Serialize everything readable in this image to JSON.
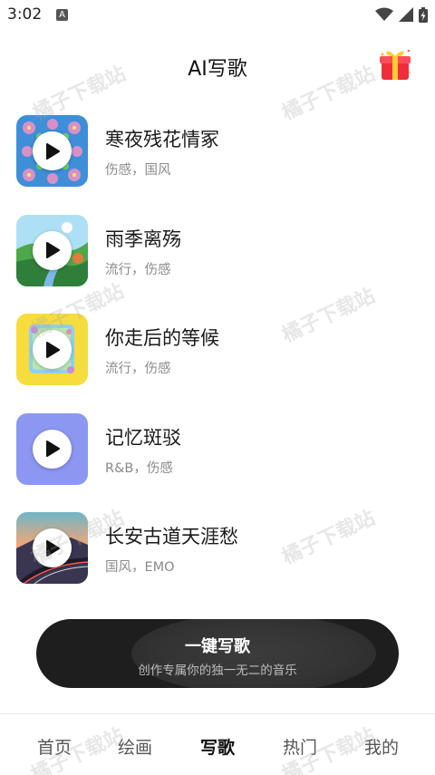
{
  "status_bar": {
    "time": "3:02",
    "notification_icon": "A",
    "icons": [
      "wifi-icon",
      "signal-icon",
      "battery-charging-icon"
    ]
  },
  "header": {
    "title": "AI写歌",
    "gift_icon": "gift-icon"
  },
  "songs": [
    {
      "title": "寒夜残花情冢",
      "tags": "伤感，国风",
      "cover": "flower-pattern"
    },
    {
      "title": "雨季离殇",
      "tags": "流行，伤感",
      "cover": "landscape-road"
    },
    {
      "title": "你走后的等候",
      "tags": "流行，伤感",
      "cover": "yellow-frame"
    },
    {
      "title": "记忆斑驳",
      "tags": "R&B，伤感",
      "cover": "periwinkle-plain"
    },
    {
      "title": "长安古道天涯愁",
      "tags": "国风，EMO",
      "cover": "sunset-highway"
    }
  ],
  "write_button": {
    "label": "一键写歌",
    "subtitle": "创作专属你的独一无二的音乐"
  },
  "bottom_nav": {
    "items": [
      {
        "label": "首页",
        "active": false
      },
      {
        "label": "绘画",
        "active": false
      },
      {
        "label": "写歌",
        "active": true
      },
      {
        "label": "热门",
        "active": false
      },
      {
        "label": "我的",
        "active": false
      }
    ]
  },
  "watermark": "橘子下载站",
  "colors": {
    "button_bg": "#1e1e1e",
    "tag_text": "#8a8a8a",
    "title_text": "#1a1a1a"
  }
}
